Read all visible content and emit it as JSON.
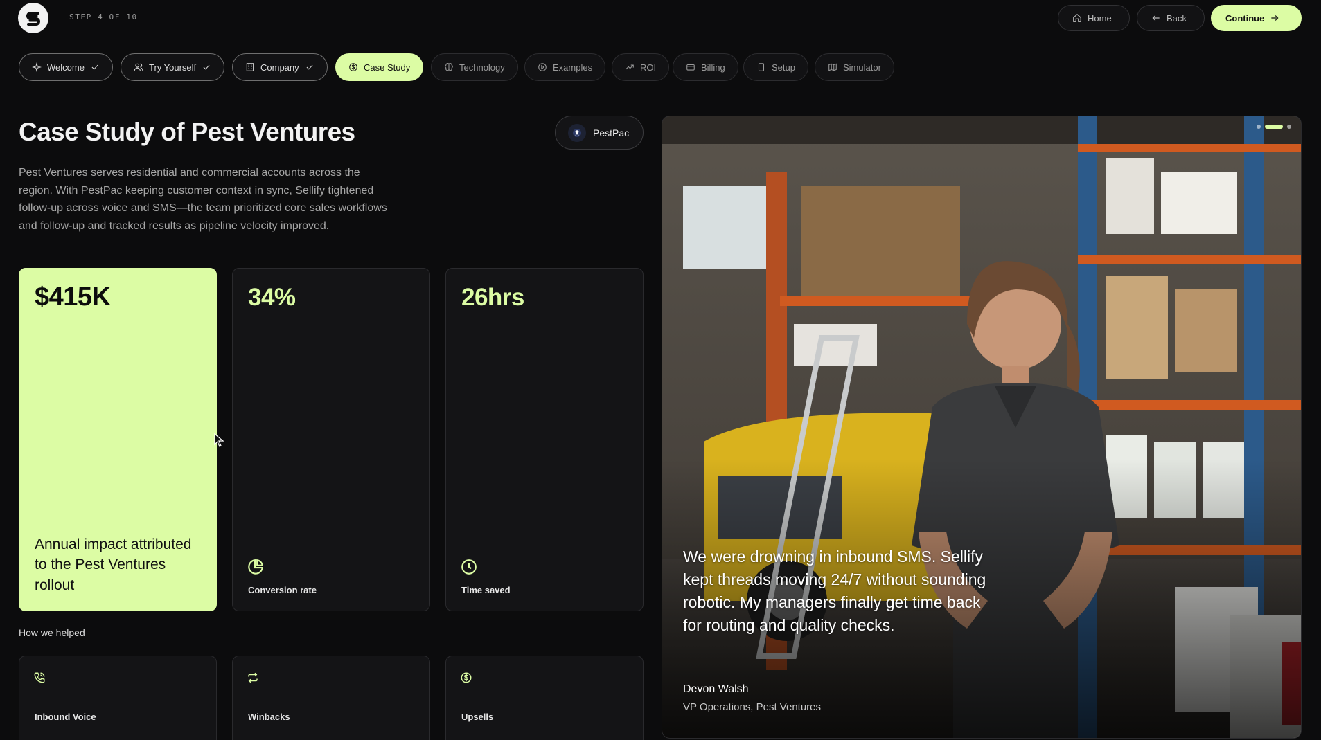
{
  "header": {
    "step_label": "STEP 4 OF 10",
    "home_label": "Home",
    "back_label": "Back",
    "continue_label": "Continue"
  },
  "tabs": [
    {
      "label": "Welcome",
      "icon": "sparkle-icon",
      "state": "done"
    },
    {
      "label": "Try Yourself",
      "icon": "users-icon",
      "state": "done"
    },
    {
      "label": "Company",
      "icon": "building-icon",
      "state": "done"
    },
    {
      "label": "Case Study",
      "icon": "dollar-icon",
      "state": "active"
    },
    {
      "label": "Technology",
      "icon": "brain-icon",
      "state": "pending"
    },
    {
      "label": "Examples",
      "icon": "play-icon",
      "state": "pending"
    },
    {
      "label": "ROI",
      "icon": "trend-icon",
      "state": "pending"
    },
    {
      "label": "Billing",
      "icon": "card-icon",
      "state": "pending"
    },
    {
      "label": "Setup",
      "icon": "device-icon",
      "state": "pending"
    },
    {
      "label": "Simulator",
      "icon": "map-icon",
      "state": "pending"
    }
  ],
  "case_study": {
    "title": "Case Study of Pest Ventures",
    "partner": "PestPac",
    "description": "Pest Ventures serves residential and commercial accounts across the region. With PestPac keeping customer context in sync, Sellify tightened follow-up across voice and SMS—the team prioritized core sales workflows and follow-up and tracked results as pipeline velocity improved."
  },
  "stats": [
    {
      "value": "$415K",
      "caption": "Annual impact attributed to the Pest Ventures rollout",
      "icon": ""
    },
    {
      "value": "34%",
      "caption": "Conversion rate",
      "icon": "pie-chart-icon"
    },
    {
      "value": "26hrs",
      "caption": "Time saved",
      "icon": "clock-icon"
    }
  ],
  "helped": {
    "label": "How we helped",
    "items": [
      {
        "label": "Inbound Voice",
        "icon": "phone-icon"
      },
      {
        "label": "Winbacks",
        "icon": "repeat-icon"
      },
      {
        "label": "Upsells",
        "icon": "dollar-circle-icon"
      }
    ]
  },
  "testimonial": {
    "quote": "We were drowning in inbound SMS. Sellify kept threads moving 24/7 without sounding robotic. My managers finally get time back for routing and quality checks.",
    "name": "Devon Walsh",
    "role": "VP Operations, Pest Ventures"
  },
  "colors": {
    "accent": "#dcfca4",
    "background": "#0c0c0d",
    "card": "#141416"
  }
}
